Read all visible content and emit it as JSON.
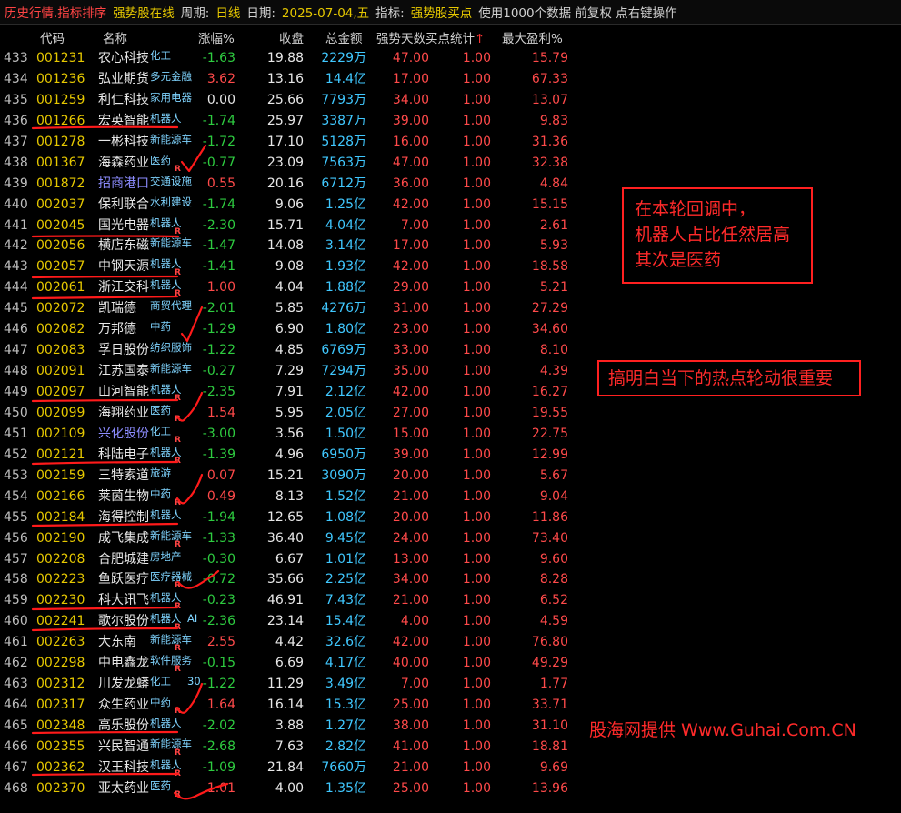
{
  "topbar": {
    "title": "历史行情.指标排序",
    "stock_pool": "强势股在线",
    "period_label": "周期:",
    "period_value": "日线",
    "date_label": "日期:",
    "date_value": "2025-07-04,五",
    "indicator_label": "指标:",
    "indicator_value": "强势股买点",
    "info": "使用1000个数据 前复权 点右键操作"
  },
  "columns": {
    "code": "代码",
    "name": "名称",
    "change": "涨幅%",
    "close": "收盘",
    "cap": "总金额",
    "days": "强势天数买点统计",
    "sort_arrow": "↑",
    "profit": "最大盈利%"
  },
  "rows": [
    {
      "idx": "433",
      "code": "001231",
      "name": "农心科技",
      "tag": "化工",
      "change": "-1.63",
      "close": "19.88",
      "cap": "2229万",
      "days": "47.00",
      "buy": "1.00",
      "profit": "15.79"
    },
    {
      "idx": "434",
      "code": "001236",
      "name": "弘业期货",
      "tag": "多元金融",
      "change": "3.62",
      "close": "13.16",
      "cap": "14.4亿",
      "days": "17.00",
      "buy": "1.00",
      "profit": "67.33"
    },
    {
      "idx": "435",
      "code": "001259",
      "name": "利仁科技",
      "tag": "家用电器",
      "change": "0.00",
      "close": "25.66",
      "cap": "7793万",
      "days": "34.00",
      "buy": "1.00",
      "profit": "13.07"
    },
    {
      "idx": "436",
      "code": "001266",
      "name": "宏英智能",
      "tag": "机器人",
      "change": "-1.74",
      "close": "25.97",
      "cap": "3387万",
      "days": "39.00",
      "buy": "1.00",
      "profit": "9.83"
    },
    {
      "idx": "437",
      "code": "001278",
      "name": "一彬科技",
      "tag": "新能源车",
      "change": "-1.72",
      "close": "17.10",
      "cap": "5128万",
      "days": "16.00",
      "buy": "1.00",
      "profit": "31.36"
    },
    {
      "idx": "438",
      "code": "001367",
      "name": "海森药业",
      "tag": "医药",
      "r": "R",
      "change": "-0.77",
      "close": "23.09",
      "cap": "7563万",
      "days": "47.00",
      "buy": "1.00",
      "profit": "32.38"
    },
    {
      "idx": "439",
      "code": "001872",
      "name": "招商港口",
      "tag": "交通设施",
      "change": "0.55",
      "close": "20.16",
      "cap": "6712万",
      "days": "36.00",
      "buy": "1.00",
      "profit": "4.84"
    },
    {
      "idx": "440",
      "code": "002037",
      "name": "保利联合",
      "tag": "水利建设",
      "change": "-1.74",
      "close": "9.06",
      "cap": "1.25亿",
      "days": "42.00",
      "buy": "1.00",
      "profit": "15.15"
    },
    {
      "idx": "441",
      "code": "002045",
      "name": "国光电器",
      "tag": "机器人",
      "r": "R",
      "change": "-2.30",
      "close": "15.71",
      "cap": "4.04亿",
      "days": "7.00",
      "buy": "1.00",
      "profit": "2.61"
    },
    {
      "idx": "442",
      "code": "002056",
      "name": "横店东磁",
      "tag": "新能源车",
      "change": "-1.47",
      "close": "14.08",
      "cap": "3.14亿",
      "days": "17.00",
      "buy": "1.00",
      "profit": "5.93"
    },
    {
      "idx": "443",
      "code": "002057",
      "name": "中钢天源",
      "tag": "机器人",
      "r": "R",
      "change": "-1.41",
      "close": "9.08",
      "cap": "1.93亿",
      "days": "42.00",
      "buy": "1.00",
      "profit": "18.58"
    },
    {
      "idx": "444",
      "code": "002061",
      "name": "浙江交科",
      "tag": "机器人",
      "r": "R",
      "change": "1.00",
      "close": "4.04",
      "cap": "1.88亿",
      "days": "29.00",
      "buy": "1.00",
      "profit": "5.21"
    },
    {
      "idx": "445",
      "code": "002072",
      "name": "凯瑞德",
      "tag": "商贸代理",
      "change": "-2.01",
      "close": "5.85",
      "cap": "4276万",
      "days": "31.00",
      "buy": "1.00",
      "profit": "27.29"
    },
    {
      "idx": "446",
      "code": "002082",
      "name": "万邦德",
      "tag": "中药",
      "change": "-1.29",
      "close": "6.90",
      "cap": "1.80亿",
      "days": "23.00",
      "buy": "1.00",
      "profit": "34.60"
    },
    {
      "idx": "447",
      "code": "002083",
      "name": "孚日股份",
      "tag": "纺织服饰",
      "change": "-1.22",
      "close": "4.85",
      "cap": "6769万",
      "days": "33.00",
      "buy": "1.00",
      "profit": "8.10"
    },
    {
      "idx": "448",
      "code": "002091",
      "name": "江苏国泰",
      "tag": "新能源车",
      "change": "-0.27",
      "close": "7.29",
      "cap": "7294万",
      "days": "35.00",
      "buy": "1.00",
      "profit": "4.39"
    },
    {
      "idx": "449",
      "code": "002097",
      "name": "山河智能",
      "tag": "机器人",
      "r": "R",
      "change": "-2.35",
      "close": "7.91",
      "cap": "2.12亿",
      "days": "42.00",
      "buy": "1.00",
      "profit": "16.27"
    },
    {
      "idx": "450",
      "code": "002099",
      "name": "海翔药业",
      "tag": "医药",
      "r": "R",
      "change": "1.54",
      "close": "5.95",
      "cap": "2.05亿",
      "days": "27.00",
      "buy": "1.00",
      "profit": "19.55"
    },
    {
      "idx": "451",
      "code": "002109",
      "name": "兴化股份",
      "tag": "化工",
      "r": "R",
      "change": "-3.00",
      "close": "3.56",
      "cap": "1.50亿",
      "days": "15.00",
      "buy": "1.00",
      "profit": "22.75"
    },
    {
      "idx": "452",
      "code": "002121",
      "name": "科陆电子",
      "tag": "机器人",
      "r": "R",
      "change": "-1.39",
      "close": "4.96",
      "cap": "6950万",
      "days": "39.00",
      "buy": "1.00",
      "profit": "12.99"
    },
    {
      "idx": "453",
      "code": "002159",
      "name": "三特索道",
      "tag": "旅游",
      "change": "0.07",
      "close": "15.21",
      "cap": "3090万",
      "days": "20.00",
      "buy": "1.00",
      "profit": "5.67"
    },
    {
      "idx": "454",
      "code": "002166",
      "name": "莱茵生物",
      "tag": "中药",
      "r": "R",
      "change": "0.49",
      "close": "8.13",
      "cap": "1.52亿",
      "days": "21.00",
      "buy": "1.00",
      "profit": "9.04"
    },
    {
      "idx": "455",
      "code": "002184",
      "name": "海得控制",
      "tag": "机器人",
      "change": "-1.94",
      "close": "12.65",
      "cap": "1.08亿",
      "days": "20.00",
      "buy": "1.00",
      "profit": "11.86"
    },
    {
      "idx": "456",
      "code": "002190",
      "name": "成飞集成",
      "tag": "新能源车",
      "r": "R",
      "change": "-1.33",
      "close": "36.40",
      "cap": "9.45亿",
      "days": "24.00",
      "buy": "1.00",
      "profit": "73.40"
    },
    {
      "idx": "457",
      "code": "002208",
      "name": "合肥城建",
      "tag": "房地产",
      "change": "-0.30",
      "close": "6.67",
      "cap": "1.01亿",
      "days": "13.00",
      "buy": "1.00",
      "profit": "9.60"
    },
    {
      "idx": "458",
      "code": "002223",
      "name": "鱼跃医疗",
      "tag": "医疗器械",
      "r": "R",
      "change": "-0.72",
      "close": "35.66",
      "cap": "2.25亿",
      "days": "34.00",
      "buy": "1.00",
      "profit": "8.28"
    },
    {
      "idx": "459",
      "code": "002230",
      "name": "科大讯飞",
      "tag": "机器人",
      "r": "R",
      "change": "-0.23",
      "close": "46.91",
      "cap": "7.43亿",
      "days": "21.00",
      "buy": "1.00",
      "profit": "6.52"
    },
    {
      "idx": "460",
      "code": "002241",
      "name": "歌尔股份",
      "tag": "机器人",
      "r": "R",
      "extra": "AI",
      "change": "-2.36",
      "close": "23.14",
      "cap": "15.4亿",
      "days": "4.00",
      "buy": "1.00",
      "profit": "4.59"
    },
    {
      "idx": "461",
      "code": "002263",
      "name": "大东南",
      "tag": "新能源车",
      "r": "R",
      "change": "2.55",
      "close": "4.42",
      "cap": "32.6亿",
      "days": "42.00",
      "buy": "1.00",
      "profit": "76.80"
    },
    {
      "idx": "462",
      "code": "002298",
      "name": "中电鑫龙",
      "tag": "软件服务",
      "r": "R",
      "change": "-0.15",
      "close": "6.69",
      "cap": "4.17亿",
      "days": "40.00",
      "buy": "1.00",
      "profit": "49.29"
    },
    {
      "idx": "463",
      "code": "002312",
      "name": "川发龙蟒",
      "tag": "化工",
      "extra": "30",
      "change": "-1.22",
      "close": "11.29",
      "cap": "3.49亿",
      "days": "7.00",
      "buy": "1.00",
      "profit": "1.77"
    },
    {
      "idx": "464",
      "code": "002317",
      "name": "众生药业",
      "tag": "中药",
      "r": "R",
      "change": "1.64",
      "close": "16.14",
      "cap": "15.3亿",
      "days": "25.00",
      "buy": "1.00",
      "profit": "33.71"
    },
    {
      "idx": "465",
      "code": "002348",
      "name": "高乐股份",
      "tag": "机器人",
      "change": "-2.02",
      "close": "3.88",
      "cap": "1.27亿",
      "days": "38.00",
      "buy": "1.00",
      "profit": "31.10"
    },
    {
      "idx": "466",
      "code": "002355",
      "name": "兴民智通",
      "tag": "新能源车",
      "r": "R",
      "change": "-2.68",
      "close": "7.63",
      "cap": "2.82亿",
      "days": "41.00",
      "buy": "1.00",
      "profit": "18.81"
    },
    {
      "idx": "467",
      "code": "002362",
      "name": "汉王科技",
      "tag": "机器人",
      "r": "R",
      "change": "-1.09",
      "close": "21.84",
      "cap": "7660万",
      "days": "21.00",
      "buy": "1.00",
      "profit": "9.69"
    },
    {
      "idx": "468",
      "code": "002370",
      "name": "亚太药业",
      "tag": "医药",
      "r": "R",
      "change": "1.01",
      "close": "4.00",
      "cap": "1.35亿",
      "days": "25.00",
      "buy": "1.00",
      "profit": "13.96"
    }
  ],
  "annotations": {
    "note1_lines": [
      "在本轮回调中，",
      "机器人占比任然居高",
      "其次是医药"
    ],
    "note2": "搞明白当下的热点轮动很重要",
    "credit": "股海网提供 Www.Guhai.Com.CN",
    "ink_color": "#ff1a1a"
  },
  "colors": {
    "up": "#ff4a4a",
    "down": "#2ecc40",
    "code": "#e6c800",
    "cap": "#40c8ff",
    "tag": "#7fd4ff"
  }
}
